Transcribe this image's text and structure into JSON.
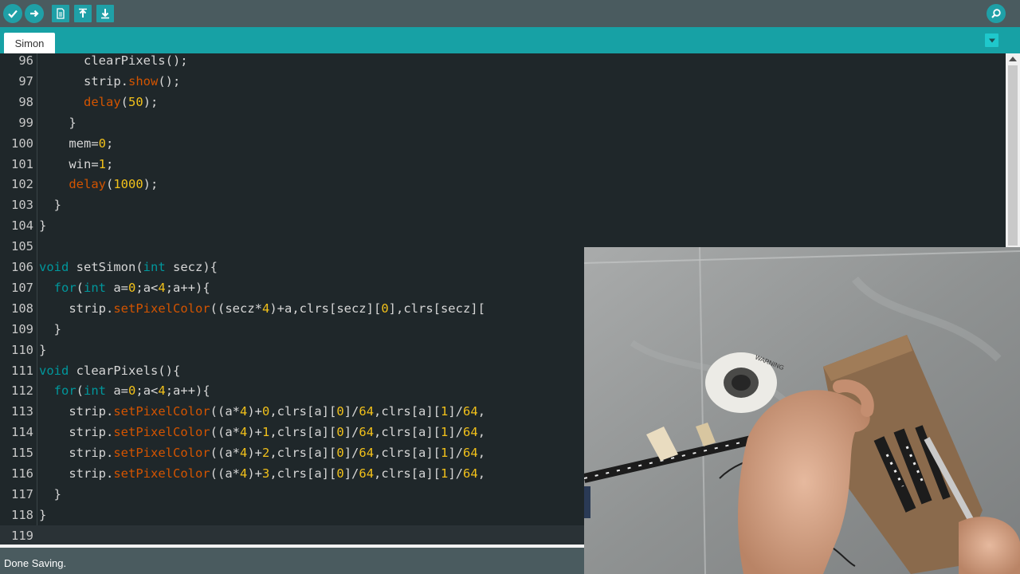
{
  "toolbar": {
    "buttons": [
      {
        "name": "verify",
        "icon": "check-icon"
      },
      {
        "name": "upload",
        "icon": "arrow-right-icon"
      },
      {
        "name": "new",
        "icon": "file-icon"
      },
      {
        "name": "open",
        "icon": "arrow-up-icon"
      },
      {
        "name": "save",
        "icon": "arrow-down-icon"
      },
      {
        "name": "serial-monitor",
        "icon": "magnifier-icon"
      }
    ]
  },
  "tabs": [
    {
      "label": "Simon"
    }
  ],
  "editor": {
    "lines": [
      {
        "n": "96",
        "tokens": [
          [
            "t",
            "      clearPixels();"
          ]
        ]
      },
      {
        "n": "97",
        "tokens": [
          [
            "t",
            "      strip."
          ],
          [
            "f",
            "show"
          ],
          [
            "t",
            "();"
          ]
        ]
      },
      {
        "n": "98",
        "tokens": [
          [
            "t",
            "      "
          ],
          [
            "f",
            "delay"
          ],
          [
            "t",
            "("
          ],
          [
            "n",
            "50"
          ],
          [
            "t",
            ");"
          ]
        ]
      },
      {
        "n": "99",
        "tokens": [
          [
            "t",
            "    }"
          ]
        ]
      },
      {
        "n": "100",
        "tokens": [
          [
            "t",
            "    mem="
          ],
          [
            "n",
            "0"
          ],
          [
            "t",
            ";"
          ]
        ]
      },
      {
        "n": "101",
        "tokens": [
          [
            "t",
            "    win="
          ],
          [
            "n",
            "1"
          ],
          [
            "t",
            ";"
          ]
        ]
      },
      {
        "n": "102",
        "tokens": [
          [
            "t",
            "    "
          ],
          [
            "f",
            "delay"
          ],
          [
            "t",
            "("
          ],
          [
            "n",
            "1000"
          ],
          [
            "t",
            ");"
          ]
        ]
      },
      {
        "n": "103",
        "tokens": [
          [
            "t",
            "  }"
          ]
        ]
      },
      {
        "n": "104",
        "tokens": [
          [
            "t",
            "}"
          ]
        ]
      },
      {
        "n": "105",
        "tokens": []
      },
      {
        "n": "106",
        "tokens": [
          [
            "k",
            "void"
          ],
          [
            "t",
            " setSimon("
          ],
          [
            "k",
            "int"
          ],
          [
            "t",
            " secz){"
          ]
        ]
      },
      {
        "n": "107",
        "tokens": [
          [
            "t",
            "  "
          ],
          [
            "k",
            "for"
          ],
          [
            "t",
            "("
          ],
          [
            "k",
            "int"
          ],
          [
            "t",
            " a="
          ],
          [
            "n",
            "0"
          ],
          [
            "t",
            ";a<"
          ],
          [
            "n",
            "4"
          ],
          [
            "t",
            ";a++){"
          ]
        ]
      },
      {
        "n": "108",
        "tokens": [
          [
            "t",
            "    strip."
          ],
          [
            "f",
            "setPixelColor"
          ],
          [
            "t",
            "((secz*"
          ],
          [
            "n",
            "4"
          ],
          [
            "t",
            ")+a,clrs[secz]["
          ],
          [
            "n",
            "0"
          ],
          [
            "t",
            "],clrs[secz]["
          ]
        ]
      },
      {
        "n": "109",
        "tokens": [
          [
            "t",
            "  }"
          ]
        ]
      },
      {
        "n": "110",
        "tokens": [
          [
            "t",
            "}"
          ]
        ]
      },
      {
        "n": "111",
        "tokens": [
          [
            "k",
            "void"
          ],
          [
            "t",
            " clearPixels(){"
          ]
        ]
      },
      {
        "n": "112",
        "tokens": [
          [
            "t",
            "  "
          ],
          [
            "k",
            "for"
          ],
          [
            "t",
            "("
          ],
          [
            "k",
            "int"
          ],
          [
            "t",
            " a="
          ],
          [
            "n",
            "0"
          ],
          [
            "t",
            ";a<"
          ],
          [
            "n",
            "4"
          ],
          [
            "t",
            ";a++){"
          ]
        ]
      },
      {
        "n": "113",
        "tokens": [
          [
            "t",
            "    strip."
          ],
          [
            "f",
            "setPixelColor"
          ],
          [
            "t",
            "((a*"
          ],
          [
            "n",
            "4"
          ],
          [
            "t",
            ")+"
          ],
          [
            "n",
            "0"
          ],
          [
            "t",
            ",clrs[a]["
          ],
          [
            "n",
            "0"
          ],
          [
            "t",
            "]/"
          ],
          [
            "n",
            "64"
          ],
          [
            "t",
            ",clrs[a]["
          ],
          [
            "n",
            "1"
          ],
          [
            "t",
            "]/"
          ],
          [
            "n",
            "64"
          ],
          [
            "t",
            ","
          ]
        ]
      },
      {
        "n": "114",
        "tokens": [
          [
            "t",
            "    strip."
          ],
          [
            "f",
            "setPixelColor"
          ],
          [
            "t",
            "((a*"
          ],
          [
            "n",
            "4"
          ],
          [
            "t",
            ")+"
          ],
          [
            "n",
            "1"
          ],
          [
            "t",
            ",clrs[a]["
          ],
          [
            "n",
            "0"
          ],
          [
            "t",
            "]/"
          ],
          [
            "n",
            "64"
          ],
          [
            "t",
            ",clrs[a]["
          ],
          [
            "n",
            "1"
          ],
          [
            "t",
            "]/"
          ],
          [
            "n",
            "64"
          ],
          [
            "t",
            ","
          ]
        ]
      },
      {
        "n": "115",
        "tokens": [
          [
            "t",
            "    strip."
          ],
          [
            "f",
            "setPixelColor"
          ],
          [
            "t",
            "((a*"
          ],
          [
            "n",
            "4"
          ],
          [
            "t",
            ")+"
          ],
          [
            "n",
            "2"
          ],
          [
            "t",
            ",clrs[a]["
          ],
          [
            "n",
            "0"
          ],
          [
            "t",
            "]/"
          ],
          [
            "n",
            "64"
          ],
          [
            "t",
            ",clrs[a]["
          ],
          [
            "n",
            "1"
          ],
          [
            "t",
            "]/"
          ],
          [
            "n",
            "64"
          ],
          [
            "t",
            ","
          ]
        ]
      },
      {
        "n": "116",
        "tokens": [
          [
            "t",
            "    strip."
          ],
          [
            "f",
            "setPixelColor"
          ],
          [
            "t",
            "((a*"
          ],
          [
            "n",
            "4"
          ],
          [
            "t",
            ")+"
          ],
          [
            "n",
            "3"
          ],
          [
            "t",
            ",clrs[a]["
          ],
          [
            "n",
            "0"
          ],
          [
            "t",
            "]/"
          ],
          [
            "n",
            "64"
          ],
          [
            "t",
            ",clrs[a]["
          ],
          [
            "n",
            "1"
          ],
          [
            "t",
            "]/"
          ],
          [
            "n",
            "64"
          ],
          [
            "t",
            ","
          ]
        ]
      },
      {
        "n": "117",
        "tokens": [
          [
            "t",
            "  }"
          ]
        ]
      },
      {
        "n": "118",
        "tokens": [
          [
            "t",
            "}"
          ]
        ]
      },
      {
        "n": "119",
        "tokens": []
      }
    ],
    "current_line": "119"
  },
  "status": {
    "message": "Done Saving."
  },
  "camera_overlay": {
    "label_text": "WARNING"
  },
  "colors": {
    "toolbar_bg": "#4a5b5f",
    "tab_bar_bg": "#17a1a5",
    "button_teal": "#1fa0a7",
    "editor_bg": "#1f272a",
    "keyword": "#00979c",
    "function": "#d35400",
    "number": "#f2c11a"
  }
}
